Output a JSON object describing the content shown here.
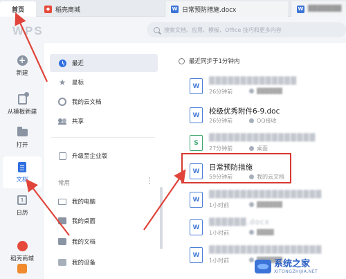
{
  "tabs": [
    {
      "label": "首页"
    },
    {
      "label": "稻壳商城"
    },
    {
      "label": "日常预防措施.docx"
    },
    {
      "label": "▓▓▓▓▓▓▓"
    }
  ],
  "header": {
    "logo": "WPS",
    "search_placeholder": "搜索文档、应用、模板、Office 技巧和更多内容"
  },
  "rail": [
    {
      "label": "新建",
      "icon": "plus-circle-icon"
    },
    {
      "label": "从模板新建",
      "icon": "template-icon"
    },
    {
      "label": "打开",
      "icon": "folder-icon"
    },
    {
      "label": "文档",
      "icon": "document-icon"
    },
    {
      "label": "日历",
      "icon": "calendar-icon"
    },
    {
      "label": "稻壳商城",
      "icon": "shop-icon"
    }
  ],
  "nav": {
    "items": [
      {
        "label": "最近",
        "icon": "clock-icon"
      },
      {
        "label": "星标",
        "icon": "star-icon"
      },
      {
        "label": "我的云文档",
        "icon": "cloud-icon"
      },
      {
        "label": "共享",
        "icon": "share-icon"
      }
    ],
    "upgrade": "升级至企业版",
    "section": "常用",
    "more": "⋮",
    "common": [
      {
        "label": "我的电脑",
        "icon": "computer-icon"
      },
      {
        "label": "我的桌面",
        "icon": "desktop-icon"
      },
      {
        "label": "我的文档",
        "icon": "documents-folder-icon"
      },
      {
        "label": "我的设备",
        "icon": "device-icon"
      }
    ]
  },
  "content": {
    "sync_status": "最近同步于1分钟内",
    "files": [
      {
        "name": "▓▓▓▓▓▓▓▓▓▓▓▓▓▓",
        "time": "26分钟前",
        "location": "▓▓▓▓▓▓",
        "type": "W"
      },
      {
        "name": "校级优秀附件6-9.doc",
        "time": "26分钟前",
        "location": "QQ接收",
        "type": "W"
      },
      {
        "name": "▓▓▓▓▓▓▓▓▓▓▓▓▓▓▓▓▓",
        "time": "27分钟前",
        "location": "桌面",
        "type": "S"
      },
      {
        "name": "日常预防措施",
        "time": "59分钟前",
        "location": "我的云文档",
        "type": "W"
      },
      {
        "name": "▓▓▓▓▓▓▓▓▓▓▓▓▓▓▓▓▓▓",
        "time": "1小时前",
        "location": "▓▓▓▓▓▓",
        "type": "W"
      },
      {
        "name": "▓▓▓▓▓▓.docx",
        "time": "1小时前",
        "location": "▓▓▓▓",
        "type": "W"
      },
      {
        "name": "▓▓▓▓▓▓▓▓▓▓▓▓▓▓▓▓▓▓",
        "time": "1小时前",
        "location": "▓▓▓▓▓▓",
        "type": "W"
      }
    ]
  },
  "watermark": {
    "main": "系统之家",
    "sub": "XITONGZHIJIA.NET"
  },
  "colors": {
    "accent": "#2f6fe0",
    "highlight_box": "#d73a31",
    "arrow": "#e0443a"
  }
}
